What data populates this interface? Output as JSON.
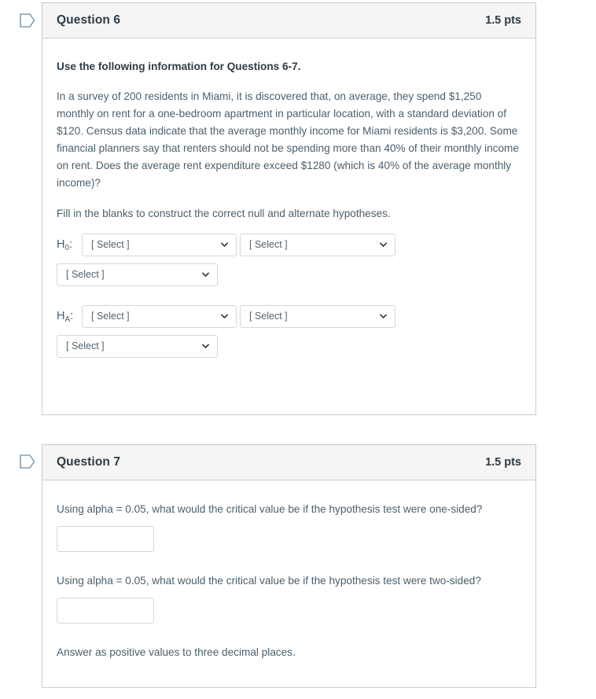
{
  "questions": [
    {
      "flag_icon": "flag-outline-icon",
      "name": "Question 6",
      "points": "1.5 pts",
      "intro_bold": "Use the following information for Questions 6-7.",
      "scenario": "In a survey of 200 residents in Miami, it is discovered that, on average, they spend $1,250 monthly on rent for a one-bedroom apartment in particular location, with a standard deviation of $120. Census data indicate that the average monthly income for Miami residents is $3,200. Some financial planners say that renters should not be spending more than 40% of their monthly income on rent. Does the average rent expenditure exceed $1280 (which is 40% of the average monthly income)?",
      "instruction": "Fill in the blanks to construct the correct null and alternate hypotheses.",
      "hypotheses": [
        {
          "label_base": "H",
          "label_sub": "0",
          "label_suffix": ":",
          "select_1": "[ Select ]",
          "select_2": "[ Select ]",
          "select_3": "[ Select ]"
        },
        {
          "label_base": "H",
          "label_sub": "A",
          "label_suffix": ":",
          "select_1": "[ Select ]",
          "select_2": "[ Select ]",
          "select_3": "[ Select ]"
        }
      ]
    },
    {
      "flag_icon": "flag-outline-icon",
      "name": "Question 7",
      "points": "1.5 pts",
      "prompt_one_sided": "Using alpha = 0.05, what would the critical value be if the hypothesis test were one-sided?",
      "answer_one_sided": "",
      "prompt_two_sided": "Using alpha = 0.05, what would the critical value be if the hypothesis test were two-sided?",
      "answer_two_sided": "",
      "footnote": "Answer as positive values to three decimal places."
    }
  ],
  "colors": {
    "header_background": "#f5f5f5",
    "card_border": "#c7cdd1",
    "body_text": "#4a5f6d",
    "heading_text": "#2d3b45",
    "flag_icon": "#6b8ba4",
    "input_border": "#d4d7da",
    "select_placeholder_text": "#54636d"
  }
}
